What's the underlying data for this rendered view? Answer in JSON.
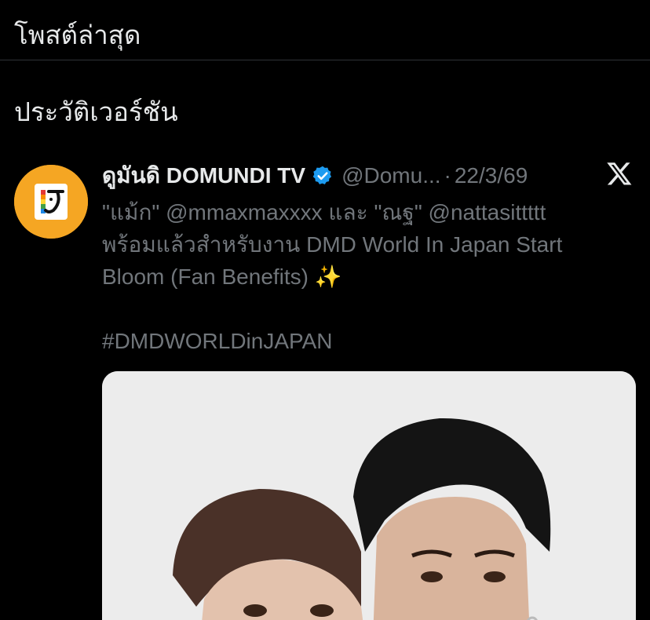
{
  "section_header": "โพสต์ล่าสุด",
  "version_heading": "ประวัติเวอร์ชัน",
  "post": {
    "display_name": "ดูมันดิ DOMUNDI TV",
    "handle": "@Domu...",
    "separator": "·",
    "date": "22/3/69",
    "text_lines": [
      "\"แม้ก\" @mmaxmaxxxx และ \"ณฐ\" @nattasittttt",
      "พร้อมแล้วสำหรับงาน DMD World In Japan Start",
      "Bloom (Fan Benefits)"
    ],
    "sparkle": "✨",
    "hashtag": "#DMDWORLDinJAPAN",
    "avatar_icon": "domundi-logo-icon",
    "verified_icon": "verified-badge-icon",
    "platform_icon": "x-logo-icon",
    "media_icon": "photo-two-men-image"
  },
  "colors": {
    "background": "#000000",
    "primary_text": "#e7e9ea",
    "secondary_text": "#71767b",
    "divider": "#2f3336",
    "verified_blue": "#1d9bf0",
    "avatar_orange": "#f5a623"
  }
}
